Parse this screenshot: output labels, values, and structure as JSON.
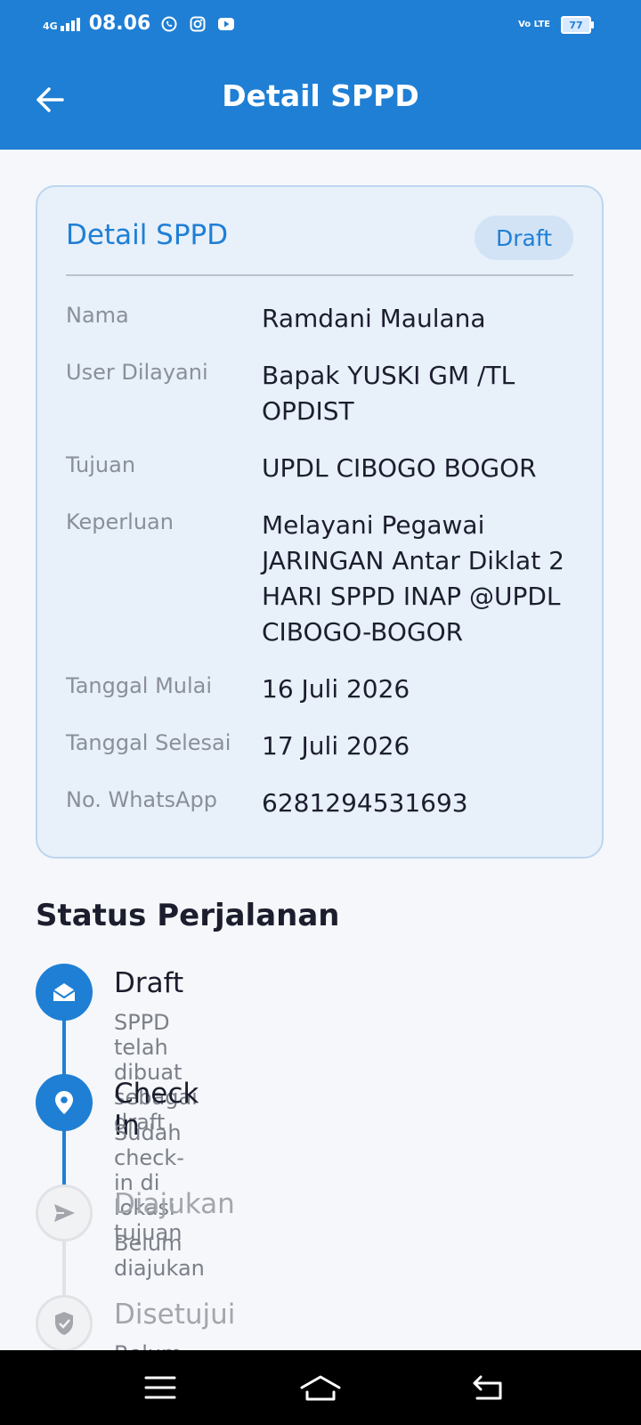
{
  "status_bar": {
    "network": "4G",
    "time": "08.06",
    "volte": "Vo LTE",
    "battery": "77"
  },
  "header": {
    "title": "Detail SPPD"
  },
  "detail_card": {
    "title": "Detail SPPD",
    "badge": "Draft",
    "fields": [
      {
        "label": "Nama",
        "value": "Ramdani Maulana"
      },
      {
        "label": "User Dilayani",
        "value": "Bapak YUSKI GM /TL OPDIST"
      },
      {
        "label": "Tujuan",
        "value": "UPDL CIBOGO BOGOR"
      },
      {
        "label": "Keperluan",
        "value": "Melayani Pegawai JARINGAN Antar Diklat 2 HARI SPPD INAP @UPDL CIBOGO-BOGOR"
      },
      {
        "label": "Tanggal Mulai",
        "value": "16 Juli 2026"
      },
      {
        "label": "Tanggal Selesai",
        "value": "17 Juli 2026"
      },
      {
        "label": "No. WhatsApp",
        "value": "6281294531693"
      }
    ]
  },
  "status_section": {
    "title": "Status Perjalanan",
    "steps": [
      {
        "title": "Draft",
        "desc": "SPPD telah dibuat sebagai draft",
        "icon": "envelope-open-icon",
        "state": "active"
      },
      {
        "title": "Check In",
        "desc": "Sudah check-in di lokasi tujuan",
        "icon": "location-pin-icon",
        "state": "active"
      },
      {
        "title": "Diajukan",
        "desc": "Belum diajukan",
        "icon": "send-icon",
        "state": "inactive"
      },
      {
        "title": "Disetujui",
        "desc": "Belum disetujui",
        "icon": "shield-check-icon",
        "state": "inactive"
      }
    ]
  },
  "colors": {
    "primary": "#1f7fd4",
    "card_bg": "#e8f0fa",
    "inactive": "#a3a6ad"
  }
}
